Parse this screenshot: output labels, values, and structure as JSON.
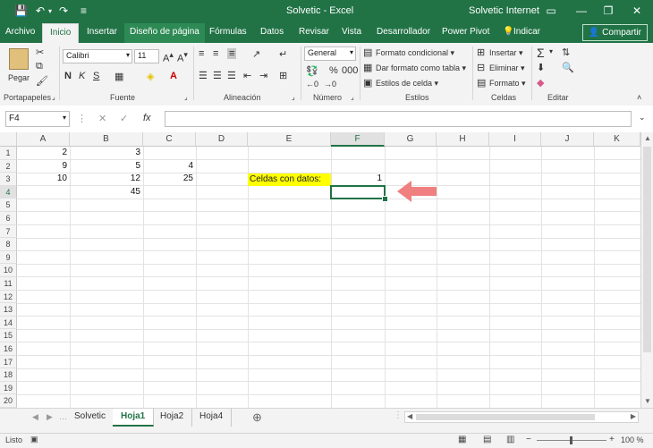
{
  "window": {
    "title": "Solvetic - Excel",
    "user": "Solvetic Internet",
    "minimize_glyph": "—",
    "restore_glyph": "❐",
    "close_glyph": "✕",
    "help_glyph": "▭"
  },
  "quick_access": {
    "save_glyph": "💾",
    "undo_glyph": "↶",
    "undo_arrow": "▾",
    "redo_glyph": "↷",
    "customize_glyph": "≡"
  },
  "tabs": [
    {
      "label": "Archivo"
    },
    {
      "label": "Inicio"
    },
    {
      "label": "Insertar"
    },
    {
      "label": "Diseño de página"
    },
    {
      "label": "Fórmulas"
    },
    {
      "label": "Datos"
    },
    {
      "label": "Revisar"
    },
    {
      "label": "Vista"
    },
    {
      "label": "Desarrollador"
    },
    {
      "label": "Power Pivot"
    }
  ],
  "tell_me": "Indicar",
  "share": "Compartir",
  "ribbon": {
    "clipboard": {
      "group": "Portapapeles",
      "paste": "Pegar"
    },
    "font": {
      "group": "Fuente",
      "name": "Calibri",
      "size": "11",
      "bold": "N",
      "italic": "K",
      "underline": "S"
    },
    "alignment": {
      "group": "Alineación"
    },
    "number": {
      "group": "Número",
      "format": "General"
    },
    "styles": {
      "group": "Estilos",
      "conditional": "Formato condicional",
      "table": "Dar formato como tabla",
      "cell_styles": "Estilos de celda"
    },
    "cells": {
      "group": "Celdas",
      "insert": "Insertar",
      "delete": "Eliminar",
      "format": "Formato"
    },
    "editing": {
      "group": "Editar"
    }
  },
  "formula_bar": {
    "name_box": "F4",
    "fx": "fx",
    "cancel": "✕",
    "enter": "✓",
    "value": ""
  },
  "columns": [
    "A",
    "B",
    "C",
    "D",
    "E",
    "F",
    "G",
    "H",
    "I",
    "J",
    "K"
  ],
  "rows": [
    "1",
    "2",
    "3",
    "4",
    "5",
    "6",
    "7",
    "8",
    "9",
    "10",
    "11",
    "12",
    "13",
    "14",
    "15",
    "16",
    "17",
    "18",
    "19",
    "20"
  ],
  "cells": {
    "a1": "2",
    "b1": "3",
    "a2": "9",
    "b2": "5",
    "c2": "4",
    "a3": "10",
    "b3": "12",
    "c3": "25",
    "b4": "45",
    "e3": "Celdas con datos:",
    "f3": "1"
  },
  "arrow_color": "#f08080",
  "sheets": [
    {
      "label": "Solvetic"
    },
    {
      "label": "Hoja1"
    },
    {
      "label": "Hoja2"
    },
    {
      "label": "Hoja4"
    }
  ],
  "add_sheet": "⊕",
  "status": {
    "ready": "Listo",
    "zoom": "100 %"
  }
}
